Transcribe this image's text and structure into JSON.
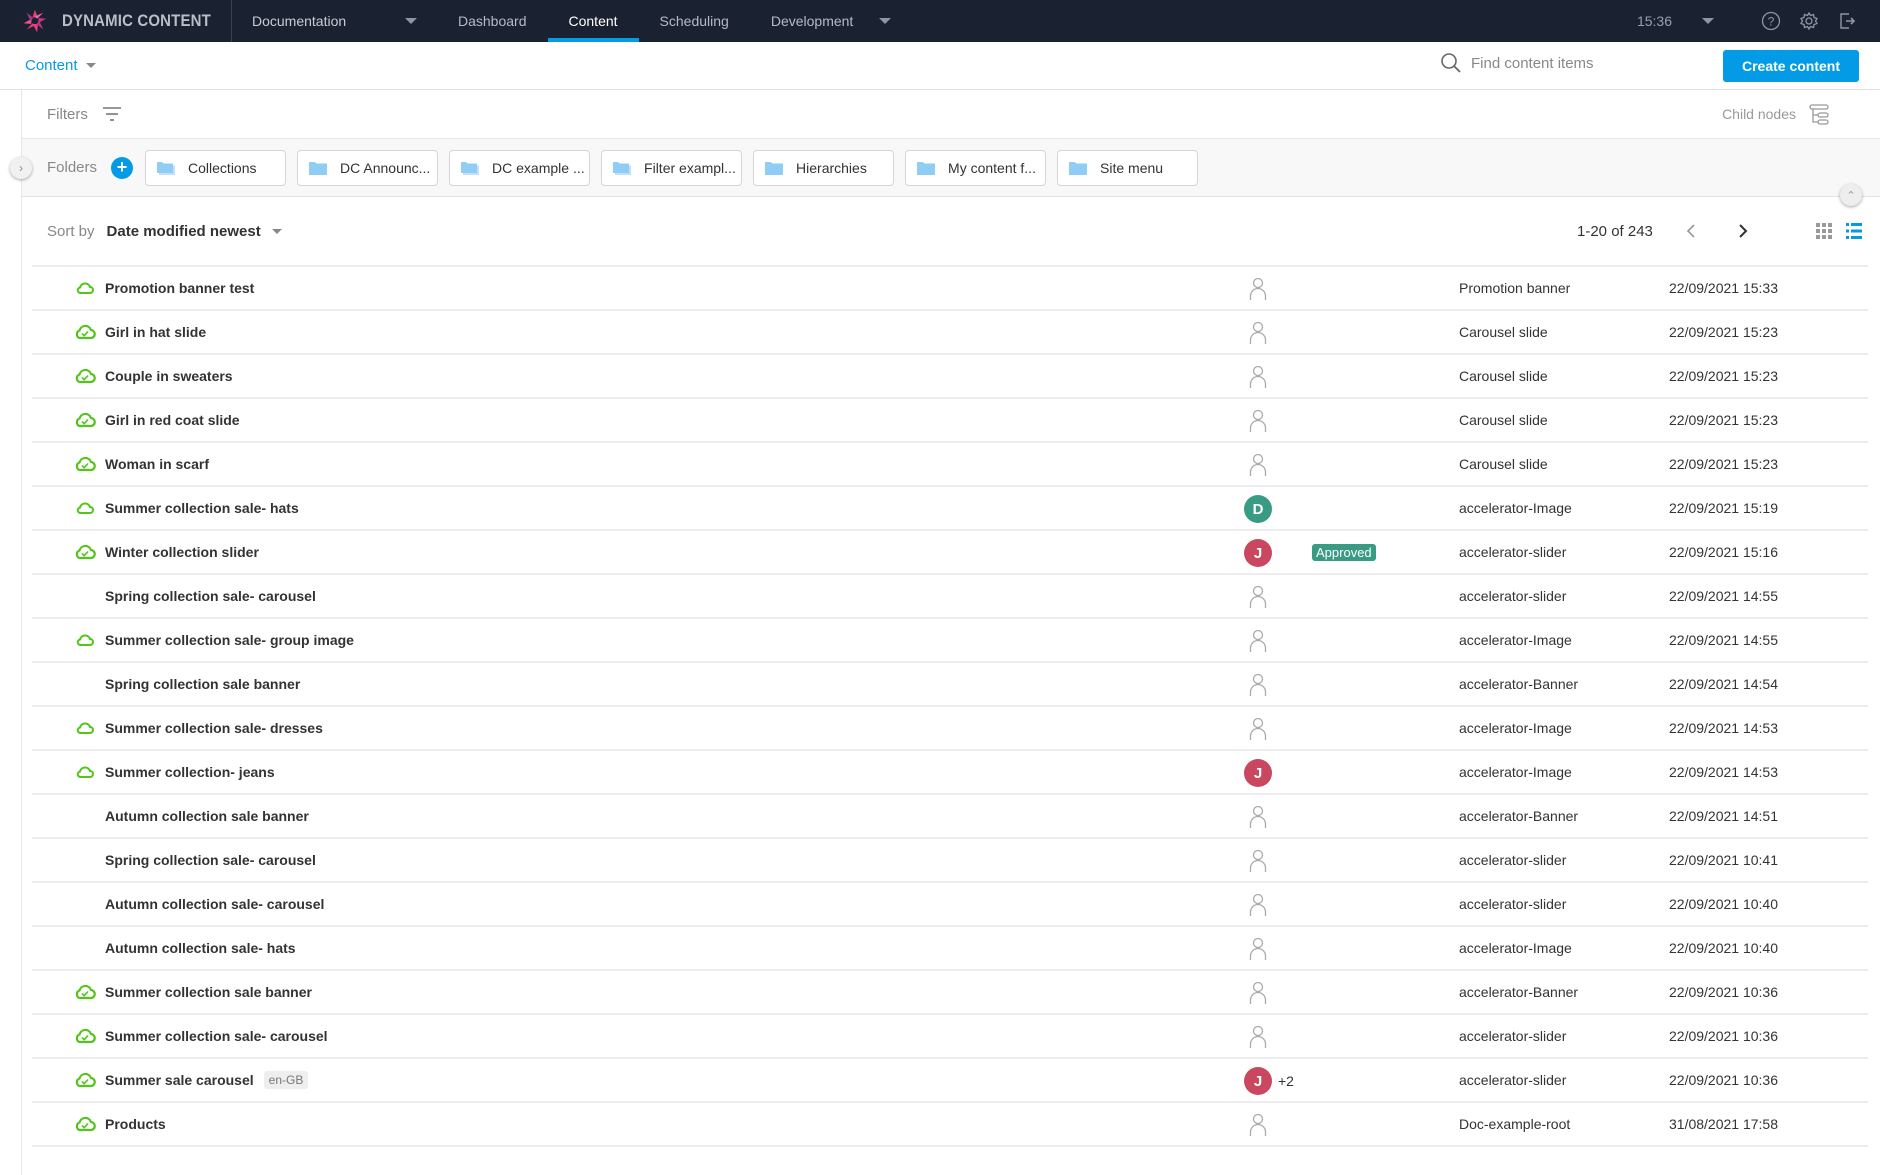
{
  "app": {
    "brand": "DYNAMIC CONTENT",
    "hub": "Documentation",
    "nav_tabs": [
      {
        "label": "Dashboard",
        "active": false
      },
      {
        "label": "Content",
        "active": true
      },
      {
        "label": "Scheduling",
        "active": false
      },
      {
        "label": "Development",
        "active": false
      }
    ],
    "clock": "15:36",
    "icons": [
      "help-icon",
      "settings-gear-icon",
      "logout-icon"
    ],
    "accent_color": "#039be5"
  },
  "subheader": {
    "section": "Content",
    "search_placeholder": "Find content items",
    "create_label": "Create content"
  },
  "filters": {
    "label": "Filters",
    "child_nodes_label": "Child nodes"
  },
  "folders": {
    "label": "Folders",
    "add_label": "+",
    "items": [
      "Collections",
      "DC Announc...",
      "DC example ...",
      "Filter exampl...",
      "Hierarchies",
      "My content f...",
      "Site menu"
    ]
  },
  "sort": {
    "label": "Sort by",
    "value": "Date modified newest"
  },
  "pagination": {
    "text": "1-20 of 243"
  },
  "rows": [
    {
      "status": "draft",
      "name": "Promotion banner test",
      "locale": "",
      "assignee": "",
      "assignee_color": "",
      "extra": "",
      "badge": "",
      "type": "Promotion banner",
      "date": "22/09/2021 15:33"
    },
    {
      "status": "published",
      "name": "Girl in hat slide",
      "locale": "",
      "assignee": "",
      "assignee_color": "",
      "extra": "",
      "badge": "",
      "type": "Carousel slide",
      "date": "22/09/2021 15:23"
    },
    {
      "status": "published",
      "name": "Couple in sweaters",
      "locale": "",
      "assignee": "",
      "assignee_color": "",
      "extra": "",
      "badge": "",
      "type": "Carousel slide",
      "date": "22/09/2021 15:23"
    },
    {
      "status": "published",
      "name": "Girl in red coat slide",
      "locale": "",
      "assignee": "",
      "assignee_color": "",
      "extra": "",
      "badge": "",
      "type": "Carousel slide",
      "date": "22/09/2021 15:23"
    },
    {
      "status": "published",
      "name": "Woman in scarf",
      "locale": "",
      "assignee": "",
      "assignee_color": "",
      "extra": "",
      "badge": "",
      "type": "Carousel slide",
      "date": "22/09/2021 15:23"
    },
    {
      "status": "draft",
      "name": "Summer collection sale- hats",
      "locale": "",
      "assignee": "D",
      "assignee_color": "#3a9b84",
      "extra": "",
      "badge": "",
      "type": "accelerator-Image",
      "date": "22/09/2021 15:19"
    },
    {
      "status": "published",
      "name": "Winter collection slider",
      "locale": "",
      "assignee": "J",
      "assignee_color": "#c9485f",
      "extra": "",
      "badge": "Approved",
      "type": "accelerator-slider",
      "date": "22/09/2021 15:16"
    },
    {
      "status": "none",
      "name": "Spring collection sale- carousel",
      "locale": "",
      "assignee": "",
      "assignee_color": "",
      "extra": "",
      "badge": "",
      "type": "accelerator-slider",
      "date": "22/09/2021 14:55"
    },
    {
      "status": "draft",
      "name": "Summer collection sale- group image",
      "locale": "",
      "assignee": "",
      "assignee_color": "",
      "extra": "",
      "badge": "",
      "type": "accelerator-Image",
      "date": "22/09/2021 14:55"
    },
    {
      "status": "none",
      "name": "Spring collection sale banner",
      "locale": "",
      "assignee": "",
      "assignee_color": "",
      "extra": "",
      "badge": "",
      "type": "accelerator-Banner",
      "date": "22/09/2021 14:54"
    },
    {
      "status": "draft",
      "name": "Summer collection sale- dresses",
      "locale": "",
      "assignee": "",
      "assignee_color": "",
      "extra": "",
      "badge": "",
      "type": "accelerator-Image",
      "date": "22/09/2021 14:53"
    },
    {
      "status": "draft",
      "name": "Summer collection- jeans",
      "locale": "",
      "assignee": "J",
      "assignee_color": "#c9485f",
      "extra": "",
      "badge": "",
      "type": "accelerator-Image",
      "date": "22/09/2021 14:53"
    },
    {
      "status": "none",
      "name": "Autumn collection sale banner",
      "locale": "",
      "assignee": "",
      "assignee_color": "",
      "extra": "",
      "badge": "",
      "type": "accelerator-Banner",
      "date": "22/09/2021 14:51"
    },
    {
      "status": "none",
      "name": "Spring collection sale- carousel",
      "locale": "",
      "assignee": "",
      "assignee_color": "",
      "extra": "",
      "badge": "",
      "type": "accelerator-slider",
      "date": "22/09/2021 10:41"
    },
    {
      "status": "none",
      "name": "Autumn collection sale- carousel",
      "locale": "",
      "assignee": "",
      "assignee_color": "",
      "extra": "",
      "badge": "",
      "type": "accelerator-slider",
      "date": "22/09/2021 10:40"
    },
    {
      "status": "none",
      "name": "Autumn collection sale- hats",
      "locale": "",
      "assignee": "",
      "assignee_color": "",
      "extra": "",
      "badge": "",
      "type": "accelerator-Image",
      "date": "22/09/2021 10:40"
    },
    {
      "status": "published",
      "name": "Summer collection sale banner",
      "locale": "",
      "assignee": "",
      "assignee_color": "",
      "extra": "",
      "badge": "",
      "type": "accelerator-Banner",
      "date": "22/09/2021 10:36"
    },
    {
      "status": "published",
      "name": "Summer collection sale- carousel",
      "locale": "",
      "assignee": "",
      "assignee_color": "",
      "extra": "",
      "badge": "",
      "type": "accelerator-slider",
      "date": "22/09/2021 10:36"
    },
    {
      "status": "published",
      "name": "Summer sale carousel",
      "locale": "en-GB",
      "assignee": "J",
      "assignee_color": "#c9485f",
      "extra": "+2",
      "badge": "",
      "type": "accelerator-slider",
      "date": "22/09/2021 10:36"
    },
    {
      "status": "published",
      "name": "Products",
      "locale": "",
      "assignee": "",
      "assignee_color": "",
      "extra": "",
      "badge": "",
      "type": "Doc-example-root",
      "date": "31/08/2021 17:58"
    }
  ]
}
